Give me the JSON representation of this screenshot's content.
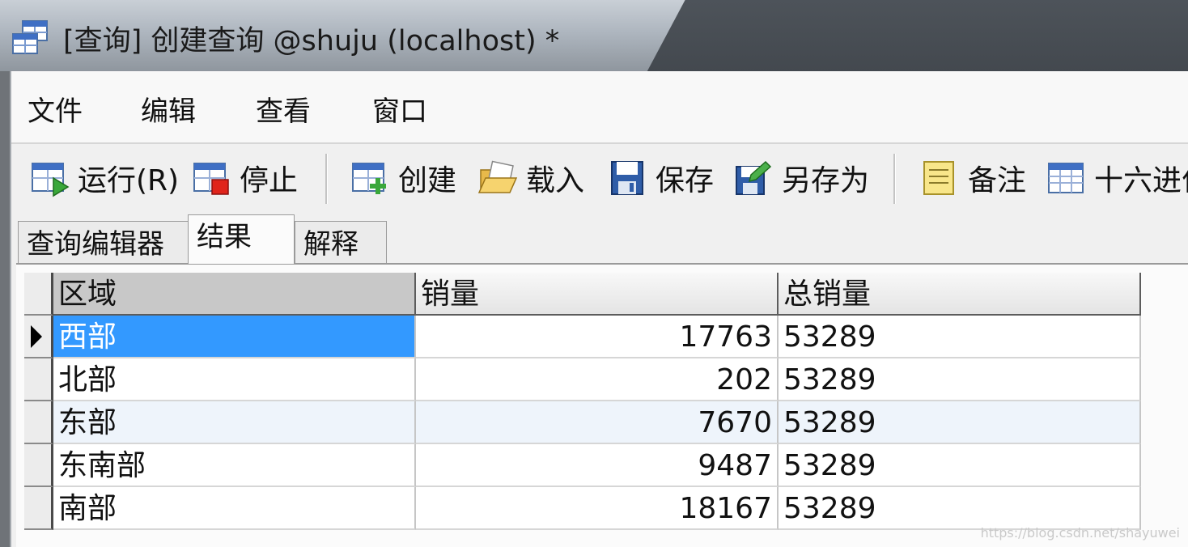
{
  "window": {
    "title": "[查询] 创建查询 @shuju (localhost) *"
  },
  "menu": [
    "文件",
    "编辑",
    "查看",
    "窗口"
  ],
  "toolbar": {
    "run": "运行(R)",
    "stop": "停止",
    "create": "创建",
    "load": "载入",
    "save": "保存",
    "save_as": "另存为",
    "note": "备注",
    "hex": "十六进位"
  },
  "tabs": [
    "查询编辑器",
    "结果",
    "解释"
  ],
  "active_tab": "结果",
  "results": {
    "columns": [
      "区域",
      "销量",
      "总销量"
    ],
    "rows": [
      {
        "区域": "西部",
        "销量": "17763",
        "总销量": "53289"
      },
      {
        "区域": "北部",
        "销量": "202",
        "总销量": "53289"
      },
      {
        "区域": "东部",
        "销量": "7670",
        "总销量": "53289"
      },
      {
        "区域": "东南部",
        "销量": "9487",
        "总销量": "53289"
      },
      {
        "区域": "南部",
        "销量": "18167",
        "总销量": "53289"
      }
    ]
  },
  "watermark": "https://blog.csdn.net/shayuwei",
  "colors": {
    "selection": "#3399ff",
    "titlebar": "#aeb6bf"
  }
}
